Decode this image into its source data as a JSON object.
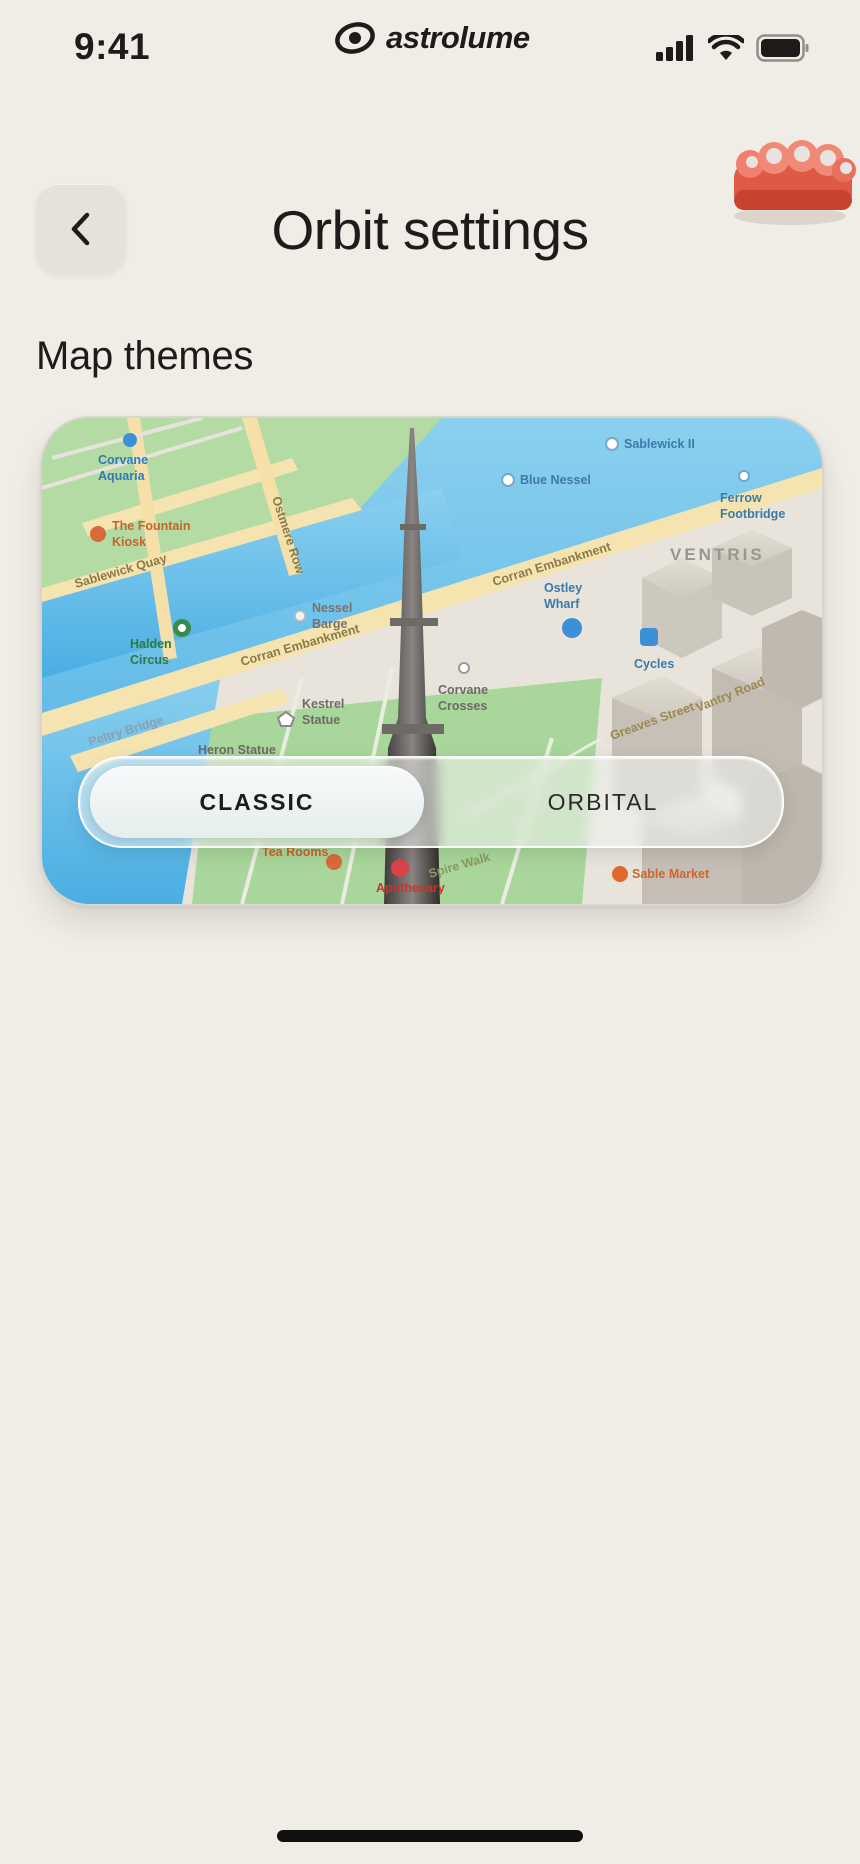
{
  "status_bar": {
    "time": "9:41",
    "brand": "astrolume"
  },
  "header": {
    "title": "Orbit settings",
    "back_label": "<"
  },
  "section": {
    "title": "Map themes"
  },
  "map": {
    "labels": {
      "corvane_aquaria_1": "Corvane",
      "corvane_aquaria_2": "Aquaria",
      "fountain_1": "The Fountain",
      "fountain_2": "Kiosk",
      "sablewick_quay": "Sablewick Quay",
      "ostmere_row": "Ostmere Row",
      "halden_1": "Halden",
      "halden_2": "Circus",
      "nessel_1": "Nessel",
      "nessel_2": "Barge",
      "corran_1": "Corran Embankment",
      "corran_2": "Corran Embankment",
      "kestrel_1": "Kestrel",
      "kestrel_2": "Statue",
      "peltry_bridge": "Peltry Bridge",
      "heron_statue": "Heron Statue",
      "sablewick_ii": "Sablewick II",
      "blue_nessel": "Blue Nessel",
      "ferrow_1": "Ferrow",
      "ferrow_2": "Footbridge",
      "ventris": "VENTRIS",
      "ostley_1": "Ostley",
      "ostley_2": "Wharf",
      "cycles": "Cycles",
      "corvane_crosses_1": "Corvane",
      "corvane_crosses_2": "Crosses",
      "greaves_street": "Greaves Street",
      "vantry_road": "Vantry Road",
      "tea_rooms": "Tea Rooms",
      "spire_walk": "Spire Walk",
      "apothecary": "Apothecary",
      "sable_market": "Sable Market"
    },
    "colors": {
      "water": "#5bb6e6",
      "park": "#a9d69a",
      "road": "#f6e4b0",
      "land": "#e8e4dc"
    }
  },
  "theme_selector": {
    "options": [
      "CLASSIC",
      "ORBITAL"
    ],
    "selected": "CLASSIC"
  }
}
